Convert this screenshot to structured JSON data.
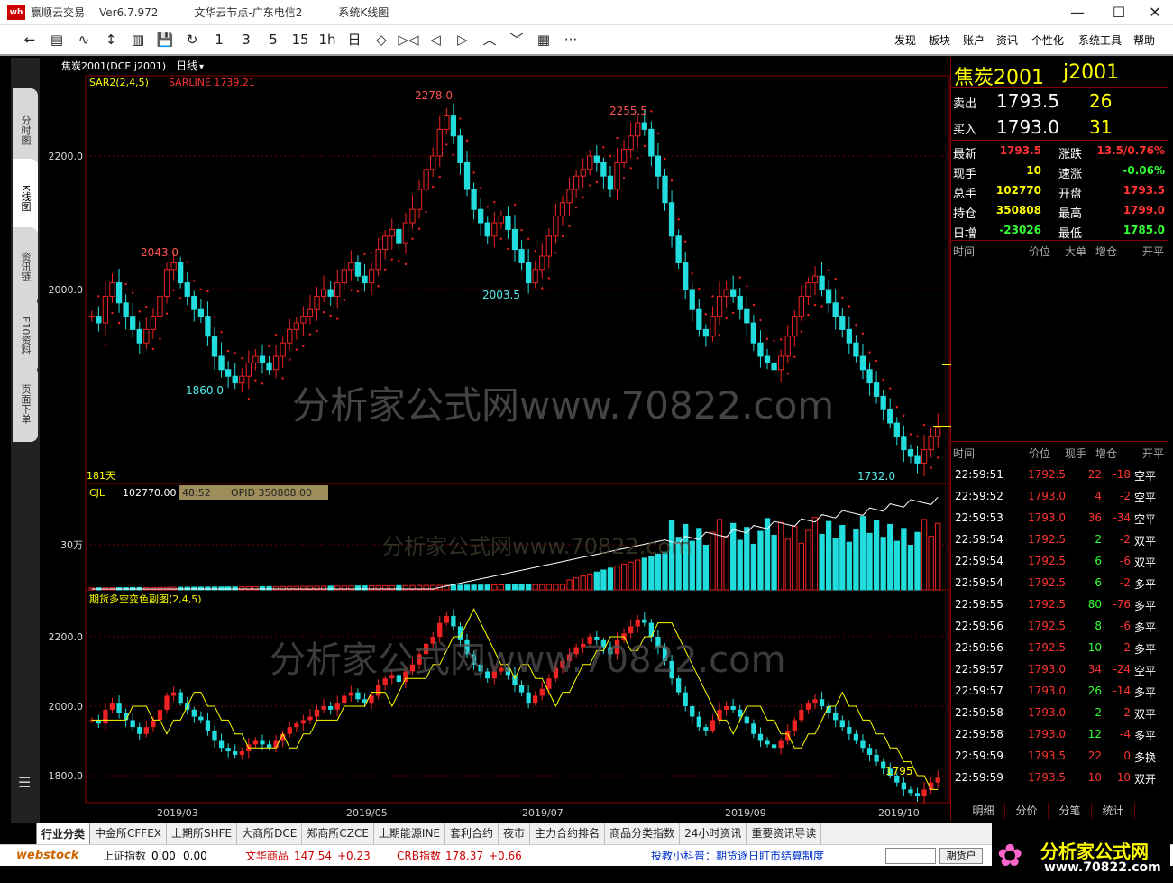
{
  "titlebar": {
    "app": "赢顺云交易",
    "version": "Ver6.7.972",
    "node": "文华云节点-广东电信2",
    "screen": "系统K线图",
    "minimize": "—",
    "maximize": "☐",
    "close": "✕"
  },
  "toolbar": {
    "icons": [
      "←",
      "▤",
      "∿",
      "↕",
      "▥",
      "💾",
      "↻",
      "1",
      "3",
      "5",
      "15",
      "1h",
      "日",
      "◇",
      "▷◁",
      "◁",
      "▷",
      "︿",
      "﹀",
      "▦",
      "···"
    ],
    "menus": [
      "发现",
      "板块",
      "账户",
      "资讯",
      "个性化",
      "系统工具",
      "帮助"
    ]
  },
  "lefttabs": [
    "分时图",
    "K线图",
    "资讯链",
    "F10资料",
    "页面下单"
  ],
  "chart": {
    "symbol_header": "焦炭2001(DCE j2001)",
    "period": "日线",
    "indicator_main": "SAR2(2,4,5)",
    "sarline": "SARLINE 1739.21",
    "days": "181天",
    "price_labels": [
      "2278.0",
      "2255.5",
      "2043.0",
      "2003.5",
      "1860.0",
      "1732.0"
    ],
    "y_main": [
      "2200.0",
      "2000.0"
    ],
    "watermark": "分析家公式网www.70822.com",
    "vol_indicator": "CJL",
    "vol_value": "102770.00",
    "vol_time": "48:52",
    "opid": "OPID 350808.00",
    "vol_axis": "30万",
    "sub_indicator": "期货多空变色副图(2,4,5)",
    "y_sub": [
      "2200.0",
      "2000.0",
      "1800.0"
    ],
    "sub_label": "1795",
    "x_labels": [
      "2019/03",
      "2019/05",
      "2019/07",
      "2019/09",
      "2019/10"
    ]
  },
  "chart_data": {
    "type": "candlestick",
    "title": "焦炭2001(DCE j2001)",
    "xlabel": "",
    "ylabel": "",
    "ylim": [
      1700,
      2300
    ],
    "x_ticks": [
      "2019/03",
      "2019/05",
      "2019/07",
      "2019/09",
      "2019/10"
    ],
    "close_series": [
      1960,
      1950,
      1990,
      2010,
      1980,
      1960,
      1940,
      1920,
      1940,
      1960,
      1990,
      2030,
      2040,
      2010,
      1990,
      1970,
      1960,
      1930,
      1900,
      1880,
      1870,
      1860,
      1870,
      1890,
      1900,
      1890,
      1880,
      1900,
      1920,
      1940,
      1950,
      1960,
      1970,
      1990,
      2000,
      1990,
      2010,
      2030,
      2040,
      2020,
      2010,
      2030,
      2060,
      2080,
      2090,
      2070,
      2100,
      2120,
      2150,
      2180,
      2200,
      2240,
      2260,
      2230,
      2190,
      2150,
      2120,
      2100,
      2080,
      2100,
      2110,
      2090,
      2060,
      2040,
      2010,
      2030,
      2050,
      2080,
      2110,
      2130,
      2150,
      2170,
      2180,
      2200,
      2190,
      2170,
      2150,
      2190,
      2210,
      2230,
      2250,
      2240,
      2200,
      2170,
      2130,
      2080,
      2040,
      2000,
      1970,
      1940,
      1930,
      1960,
      1990,
      2000,
      1990,
      1970,
      1950,
      1920,
      1900,
      1890,
      1880,
      1900,
      1930,
      1960,
      1990,
      2010,
      2020,
      2000,
      1980,
      1960,
      1940,
      1920,
      1900,
      1880,
      1860,
      1840,
      1820,
      1800,
      1780,
      1760,
      1750,
      1740,
      1760,
      1780,
      1793.5
    ],
    "annotations": [
      {
        "label": "2278.0",
        "value": 2278.0
      },
      {
        "label": "2255.5",
        "value": 2255.5
      },
      {
        "label": "2043.0",
        "value": 2043.0
      },
      {
        "label": "2003.5",
        "value": 2003.5
      },
      {
        "label": "1860.0",
        "value": 1860.0
      },
      {
        "label": "1732.0",
        "value": 1732.0
      }
    ]
  },
  "quote": {
    "name": "焦炭2001",
    "code": "j2001",
    "sell_label": "卖出",
    "sell_price": "1793.5",
    "sell_vol": "26",
    "buy_label": "买入",
    "buy_price": "1793.0",
    "buy_vol": "31",
    "rows": [
      [
        "最新",
        "1793.5",
        "涨跌",
        "13.5/0.76%"
      ],
      [
        "现手",
        "10",
        "速涨",
        "-0.06%"
      ],
      [
        "总手",
        "102770",
        "开盘",
        "1793.5"
      ],
      [
        "持仓",
        "350808",
        "最高",
        "1799.0"
      ],
      [
        "日增",
        "-23026",
        "最低",
        "1785.0"
      ]
    ],
    "head1": [
      "时间",
      "价位",
      "大单",
      "增仓",
      "开平"
    ],
    "head2": [
      "时间",
      "价位",
      "现手",
      "增仓",
      "开平"
    ],
    "ticks": [
      [
        "22:59:51",
        "1792.5",
        "22",
        "-18",
        "空平"
      ],
      [
        "22:59:52",
        "1793.0",
        "4",
        "-2",
        "空平"
      ],
      [
        "22:59:53",
        "1793.0",
        "36",
        "-34",
        "空平"
      ],
      [
        "22:59:54",
        "1792.5",
        "2",
        "-2",
        "双平"
      ],
      [
        "22:59:54",
        "1792.5",
        "6",
        "-6",
        "双平"
      ],
      [
        "22:59:54",
        "1792.5",
        "6",
        "-2",
        "多平"
      ],
      [
        "22:59:55",
        "1792.5",
        "80",
        "-76",
        "多平"
      ],
      [
        "22:59:56",
        "1792.5",
        "8",
        "-6",
        "多平"
      ],
      [
        "22:59:56",
        "1792.5",
        "10",
        "-2",
        "多平"
      ],
      [
        "22:59:57",
        "1793.0",
        "34",
        "-24",
        "空平"
      ],
      [
        "22:59:57",
        "1793.0",
        "26",
        "-14",
        "多平"
      ],
      [
        "22:59:58",
        "1793.0",
        "2",
        "-2",
        "双平"
      ],
      [
        "22:59:58",
        "1793.0",
        "12",
        "-4",
        "多平"
      ],
      [
        "22:59:59",
        "1793.5",
        "22",
        "0",
        "多换"
      ],
      [
        "22:59:59",
        "1793.5",
        "10",
        "10",
        "双开"
      ]
    ],
    "subtabs": [
      "明细",
      "分价",
      "分笔",
      "统计"
    ]
  },
  "bottomtabs": [
    "行业分类",
    "中金所CFFEX",
    "上期所SHFE",
    "大商所DCE",
    "郑商所CZCE",
    "上期能源INE",
    "套利合约",
    "夜市",
    "主力合约排名",
    "商品分类指数",
    "24小时资讯",
    "重要资讯导读"
  ],
  "status": {
    "logo": "webstock",
    "sh_label": "上证指数",
    "sh_val": "0.00",
    "sh_chg": "0.00",
    "wh_label": "文华商品",
    "wh_val": "147.54",
    "wh_chg": "+0.23",
    "crb_label": "CRB指数",
    "crb_val": "178.37",
    "crb_chg": "+0.66",
    "tip": "投教小科普：期货逐日盯市结算制度",
    "btn": "期货户"
  },
  "brand": {
    "name": "分析家公式网",
    "url": "www.70822.com"
  }
}
